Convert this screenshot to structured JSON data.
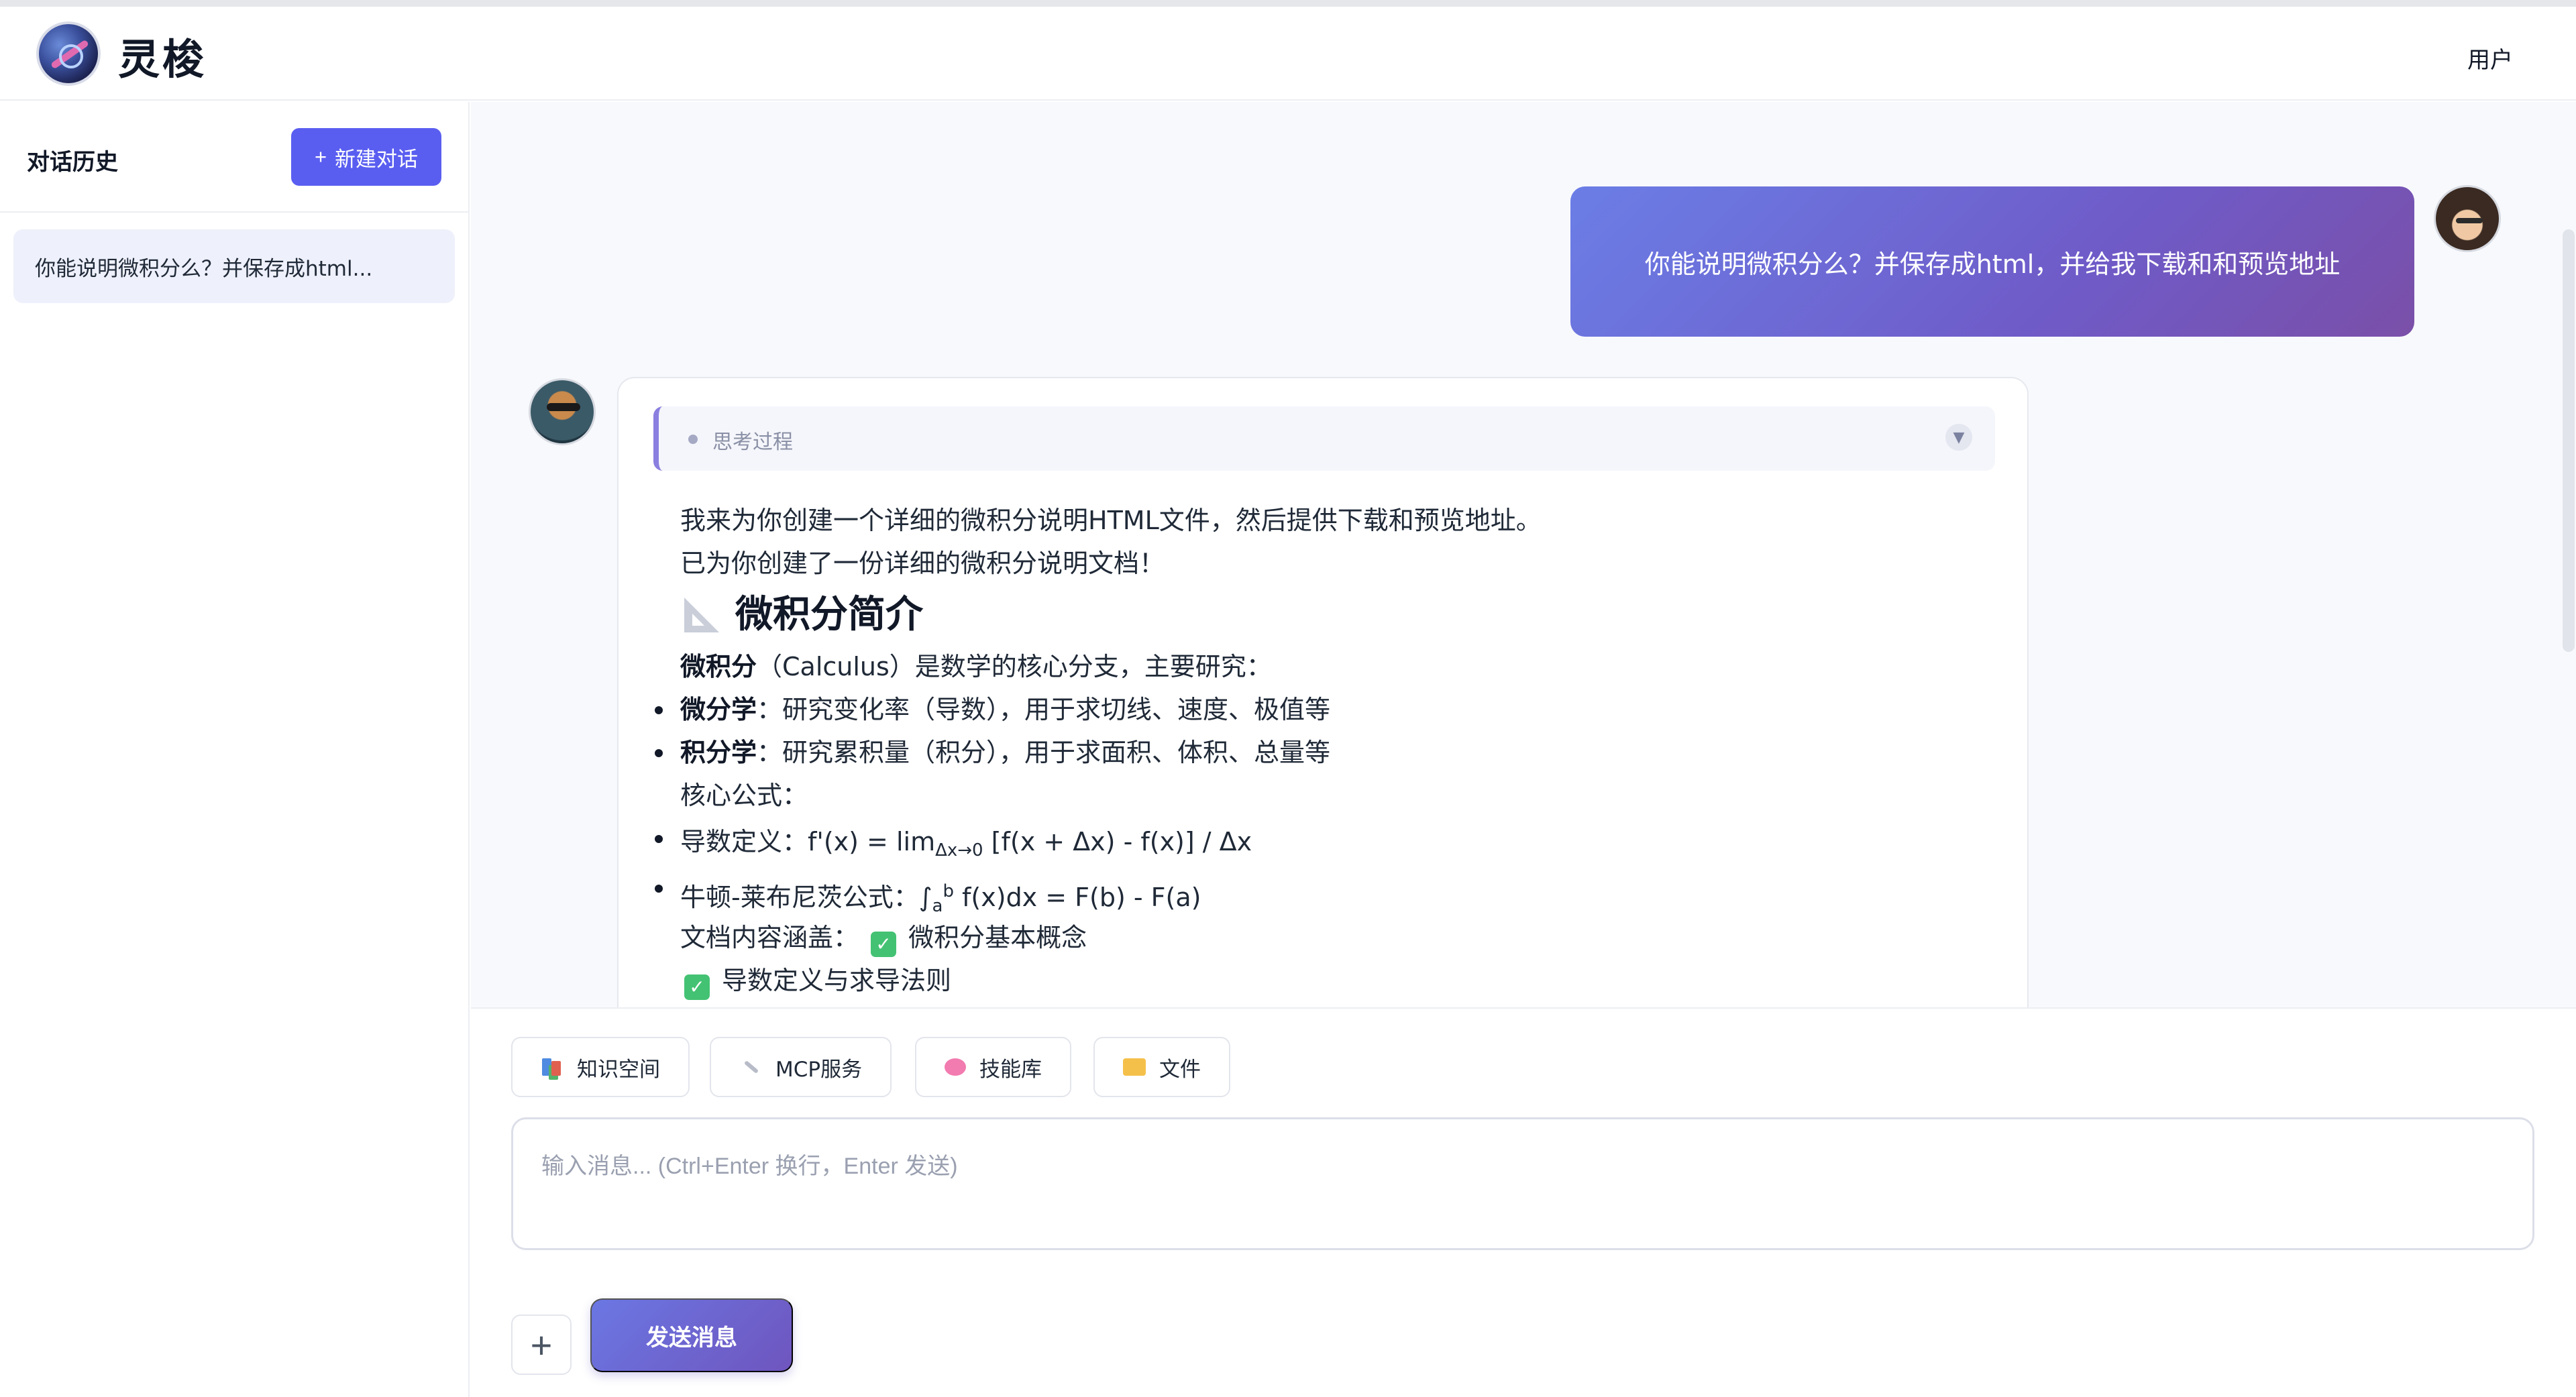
{
  "app": {
    "title": "灵梭",
    "user_label": "用户"
  },
  "sidebar": {
    "title": "对话历史",
    "new_chat_label": "新建对话",
    "history": [
      {
        "label": "你能说明微积分么？并保存成html..."
      }
    ]
  },
  "chat": {
    "user_message": "你能说明微积分么？并保存成html，并给我下载和和预览地址",
    "thinking_label": "思考过程",
    "response": {
      "line1": "我来为你创建一个详细的微积分说明HTML文件，然后提供下载和预览地址。",
      "line2": "已为你创建了一份详细的微积分说明文档！",
      "heading": "微积分简介",
      "intro_bold": "微积分",
      "intro_rest": "（Calculus）是数学的核心分支，主要研究：",
      "bullet1_bold": "微分学",
      "bullet1_rest": "：研究变化率（导数），用于求切线、速度、极值等",
      "bullet2_bold": "积分学",
      "bullet2_rest": "：研究累积量（积分），用于求面积、体积、总量等",
      "core_formula": "核心公式：",
      "deriv_prefix": "导数定义：f'(x) = lim",
      "deriv_sub": "Δx→0",
      "deriv_suffix": " [f(x + Δx) - f(x)] / Δx",
      "nl_prefix": "牛顿-莱布尼茨公式：∫",
      "nl_sub": "a",
      "nl_sup": "b",
      "nl_suffix": " f(x)dx = F(b) - F(a)",
      "coverage_label": "文档内容涵盖：",
      "coverage_items": [
        "微积分基本概念",
        "导数定义与求导法则"
      ]
    }
  },
  "composer": {
    "tools": [
      {
        "label": "知识空间",
        "icon": "books-icon"
      },
      {
        "label": "MCP服务",
        "icon": "wrench-icon"
      },
      {
        "label": "技能库",
        "icon": "brain-icon"
      },
      {
        "label": "文件",
        "icon": "folder-icon"
      }
    ],
    "placeholder": "输入消息... (Ctrl+Enter 换行，Enter 发送)",
    "add_label": "+",
    "send_label": "发送消息"
  }
}
